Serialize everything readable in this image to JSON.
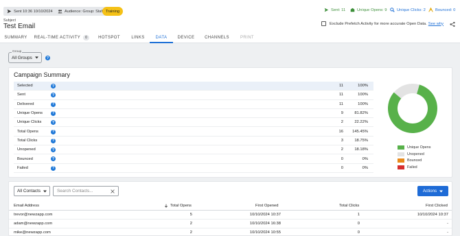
{
  "header": {
    "sent_chip": "Sent 10:36 10/10/2024",
    "audience_chip": "Audience: Group: Staff",
    "training_badge": "Training",
    "stats": {
      "sent": "Sent: 11",
      "unique_opens": "Unique Opens: 9",
      "unique_clicks": "Unique Clicks: 2",
      "bounced": "Bounced: 0"
    },
    "subject_label": "Subject",
    "subject": "Test Email",
    "exclude_text": "Exclude Prefetch Activity for more accurate Open Data.",
    "see_why": "See why"
  },
  "tabs": [
    {
      "label": "SUMMARY"
    },
    {
      "label": "REAL-TIME ACTIVITY",
      "count": "0"
    },
    {
      "label": "HOTSPOT"
    },
    {
      "label": "LINKS"
    },
    {
      "label": "DATA"
    },
    {
      "label": "DEVICE"
    },
    {
      "label": "CHANNELS"
    },
    {
      "label": "PRINT"
    }
  ],
  "group": {
    "label": "Group",
    "value": "All Groups"
  },
  "summary": {
    "title": "Campaign Summary",
    "rows": [
      {
        "label": "Selected",
        "count": "11",
        "pct": "100%"
      },
      {
        "label": "Sent",
        "count": "11",
        "pct": "100%"
      },
      {
        "label": "Delivered",
        "count": "11",
        "pct": "100%"
      },
      {
        "label": "Unique Opens",
        "count": "9",
        "pct": "81.82%"
      },
      {
        "label": "Unique Clicks",
        "count": "2",
        "pct": "22.22%"
      },
      {
        "label": "Total Opens",
        "count": "16",
        "pct": "145.45%"
      },
      {
        "label": "Total Clicks",
        "count": "3",
        "pct": "18.75%"
      },
      {
        "label": "Unopened",
        "count": "2",
        "pct": "18.18%"
      },
      {
        "label": "Bounced",
        "count": "0",
        "pct": "0%"
      },
      {
        "label": "Failed",
        "count": "0",
        "pct": "0%"
      }
    ]
  },
  "chart_data": {
    "type": "pie",
    "categories": [
      "Unique Opens",
      "Unopened",
      "Bounced",
      "Failed"
    ],
    "values": [
      9,
      2,
      0,
      0
    ],
    "colors": [
      "#58b14a",
      "#e3e3e3",
      "#e88a1a",
      "#d62f2f"
    ]
  },
  "contacts": {
    "filter": "All Contacts",
    "search_placeholder": "Search Contacts...",
    "actions_label": "Actions",
    "columns": [
      "Email Address",
      "Total Opens",
      "First Opened",
      "Total Clicks",
      "First Clicked"
    ],
    "rows": [
      [
        "trevor@newzapp.com",
        "5",
        "10/10/2024 10:37",
        "1",
        "10/10/2024 10:37"
      ],
      [
        "adam@newzapp.com",
        "2",
        "10/10/2024 16:38",
        "0",
        "-"
      ],
      [
        "mike@newzapp.com",
        "2",
        "10/10/2024 10:55",
        "0",
        "-"
      ]
    ]
  },
  "colors": {
    "accent": "#1d6fd6",
    "training": "#f5c116",
    "sent": "#3d8f3a",
    "opens": "#3d8f3a",
    "clicks": "#1d6fd6",
    "bounced": "#1d6fd6"
  }
}
